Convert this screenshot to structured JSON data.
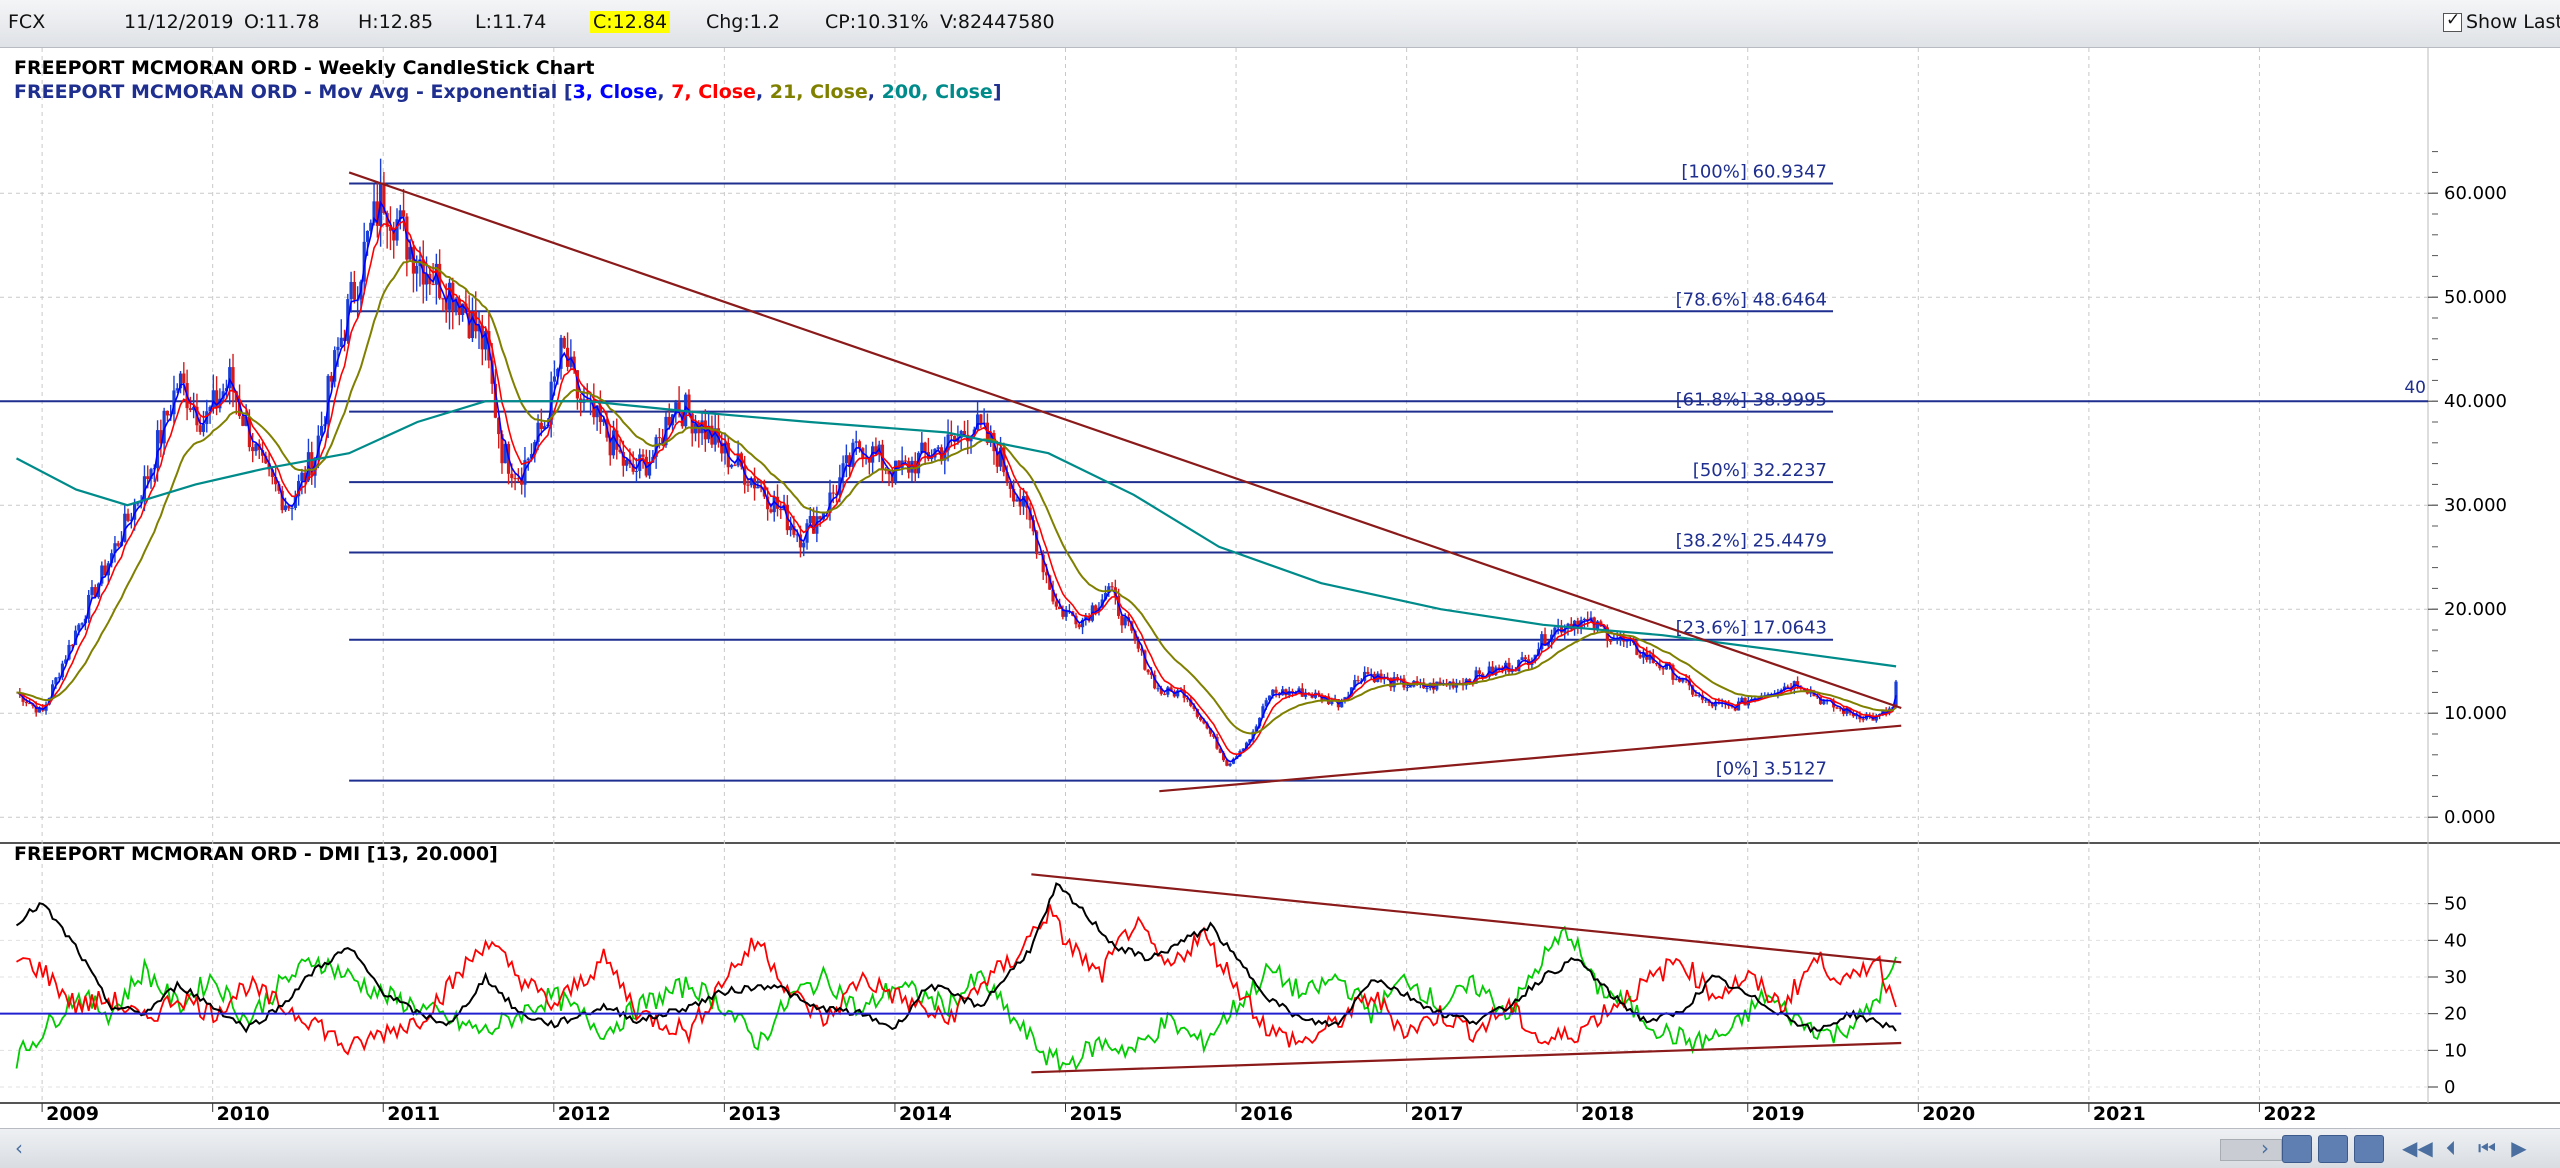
{
  "toolbar": {
    "symbol": "FCX",
    "date": "11/12/2019",
    "open": "O:11.78",
    "high": "H:12.85",
    "low": "L:11.74",
    "close": "C:12.84",
    "change": "Chg:1.2",
    "change_pct": "CP:10.31%",
    "volume": "V:82447580",
    "show_last_label": "Show Last",
    "show_last_checked": true
  },
  "colors": {
    "ema3": "#0000ff",
    "ema7": "#ff0000",
    "ema21": "#808000",
    "ema200": "#008b8b",
    "fib": "#1f2f8f",
    "trend": "#8b1a1a",
    "di_plus": "#00cc00",
    "di_minus": "#ff0000",
    "adx": "#000000",
    "close_highlight": "#ffff00"
  },
  "chart_data": [
    {
      "type": "candlestick",
      "title": "FREEPORT MCMORAN ORD - Weekly CandleStick Chart",
      "subtitle": {
        "prefix": "FREEPORT MCMORAN ORD - Mov Avg - Exponential [",
        "items": [
          {
            "text": "3, Close",
            "color": "#0000ff"
          },
          {
            "text": "7, Close",
            "color": "#ff0000"
          },
          {
            "text": "21, Close",
            "color": "#808000"
          },
          {
            "text": "200, Close",
            "color": "#008b8b"
          }
        ],
        "suffix": "]"
      },
      "x_labels": [
        "2009",
        "2010",
        "2011",
        "2012",
        "2013",
        "2014",
        "2015",
        "2016",
        "2017",
        "2018",
        "2019",
        "2020",
        "2021",
        "2022"
      ],
      "xlim": [
        2008.8,
        2023.0
      ],
      "ylim": [
        -2,
        68
      ],
      "y_ticks": [
        "0.000",
        "10.000",
        "20.000",
        "30.000",
        "40.000",
        "50.000",
        "60.000"
      ],
      "grid": true,
      "price_path": [
        [
          2008.85,
          12
        ],
        [
          2009.0,
          10
        ],
        [
          2009.2,
          18
        ],
        [
          2009.4,
          25
        ],
        [
          2009.6,
          32
        ],
        [
          2009.8,
          42
        ],
        [
          2009.95,
          38
        ],
        [
          2010.1,
          42
        ],
        [
          2010.3,
          33
        ],
        [
          2010.45,
          30
        ],
        [
          2010.6,
          35
        ],
        [
          2010.75,
          46
        ],
        [
          2010.9,
          55
        ],
        [
          2011.0,
          60
        ],
        [
          2011.15,
          55
        ],
        [
          2011.3,
          52
        ],
        [
          2011.45,
          50
        ],
        [
          2011.6,
          45
        ],
        [
          2011.7,
          35
        ],
        [
          2011.8,
          33
        ],
        [
          2011.95,
          38
        ],
        [
          2012.05,
          45
        ],
        [
          2012.15,
          40
        ],
        [
          2012.3,
          37
        ],
        [
          2012.45,
          33
        ],
        [
          2012.6,
          35
        ],
        [
          2012.7,
          40
        ],
        [
          2012.85,
          38
        ],
        [
          2013.0,
          35
        ],
        [
          2013.2,
          32
        ],
        [
          2013.45,
          27
        ],
        [
          2013.6,
          30
        ],
        [
          2013.8,
          36
        ],
        [
          2014.0,
          33
        ],
        [
          2014.2,
          35
        ],
        [
          2014.35,
          36
        ],
        [
          2014.45,
          38
        ],
        [
          2014.6,
          35
        ],
        [
          2014.8,
          28
        ],
        [
          2014.95,
          20
        ],
        [
          2015.1,
          19
        ],
        [
          2015.25,
          22
        ],
        [
          2015.4,
          17
        ],
        [
          2015.55,
          12
        ],
        [
          2015.7,
          12
        ],
        [
          2015.85,
          8
        ],
        [
          2015.95,
          5
        ],
        [
          2016.1,
          8
        ],
        [
          2016.2,
          12
        ],
        [
          2016.4,
          12
        ],
        [
          2016.6,
          11
        ],
        [
          2016.75,
          14
        ],
        [
          2016.9,
          13
        ],
        [
          2017.1,
          12.5
        ],
        [
          2017.3,
          13
        ],
        [
          2017.5,
          14
        ],
        [
          2017.7,
          15
        ],
        [
          2017.85,
          18
        ],
        [
          2018.0,
          19
        ],
        [
          2018.15,
          18
        ],
        [
          2018.35,
          16
        ],
        [
          2018.55,
          14
        ],
        [
          2018.75,
          11
        ],
        [
          2018.9,
          10.5
        ],
        [
          2019.1,
          12
        ],
        [
          2019.3,
          13
        ],
        [
          2019.45,
          11
        ],
        [
          2019.6,
          10
        ],
        [
          2019.75,
          9.5
        ],
        [
          2019.85,
          10.5
        ],
        [
          2019.87,
          12.84
        ]
      ],
      "ema200_path": [
        [
          2008.85,
          34.5
        ],
        [
          2009.2,
          31.5
        ],
        [
          2009.5,
          30
        ],
        [
          2009.9,
          32
        ],
        [
          2010.3,
          33.5
        ],
        [
          2010.8,
          35
        ],
        [
          2011.2,
          38
        ],
        [
          2011.6,
          40
        ],
        [
          2012.2,
          40
        ],
        [
          2012.8,
          39
        ],
        [
          2013.5,
          38
        ],
        [
          2014.3,
          37
        ],
        [
          2014.9,
          35
        ],
        [
          2015.4,
          31
        ],
        [
          2015.9,
          26
        ],
        [
          2016.5,
          22.5
        ],
        [
          2017.2,
          20
        ],
        [
          2017.8,
          18.5
        ],
        [
          2018.5,
          17.5
        ],
        [
          2019.2,
          16
        ],
        [
          2019.87,
          14.5
        ]
      ],
      "fib_levels": [
        {
          "label": "[100%] 60.9347",
          "value": 60.9347
        },
        {
          "label": "[78.6%] 48.6464",
          "value": 48.6464
        },
        {
          "label": "[61.8%] 38.9995",
          "value": 38.9995
        },
        {
          "label": "[50%] 32.2237",
          "value": 32.2237
        },
        {
          "label": "[38.2%] 25.4479",
          "value": 25.4479
        },
        {
          "label": "[23.6%] 17.0643",
          "value": 17.0643
        },
        {
          "label": "[0%] 3.5127",
          "value": 3.5127
        }
      ],
      "fib_x_range": [
        2010.8,
        2019.5
      ],
      "horizontal_line": {
        "value": 40,
        "label": "40"
      },
      "trendlines": [
        {
          "from": [
            2010.8,
            62
          ],
          "to": [
            2019.9,
            10.5
          ]
        },
        {
          "from": [
            2015.55,
            2.5
          ],
          "to": [
            2019.9,
            8.8
          ]
        }
      ]
    },
    {
      "type": "line",
      "title": "FREEPORT MCMORAN ORD - DMI [13, 20.000]",
      "ylim": [
        -3,
        57
      ],
      "y_ticks": [
        "0",
        "10",
        "20",
        "30",
        "40",
        "50"
      ],
      "horizontal_line": 20,
      "adx_path": [
        [
          2008.85,
          45
        ],
        [
          2009.0,
          50
        ],
        [
          2009.2,
          38
        ],
        [
          2009.4,
          22
        ],
        [
          2009.6,
          20
        ],
        [
          2009.8,
          28
        ],
        [
          2010.0,
          22
        ],
        [
          2010.2,
          16
        ],
        [
          2010.4,
          22
        ],
        [
          2010.6,
          32
        ],
        [
          2010.8,
          38
        ],
        [
          2011.0,
          26
        ],
        [
          2011.2,
          20
        ],
        [
          2011.4,
          17
        ],
        [
          2011.6,
          30
        ],
        [
          2011.8,
          20
        ],
        [
          2012.0,
          17
        ],
        [
          2012.3,
          22
        ],
        [
          2012.5,
          18
        ],
        [
          2012.8,
          22
        ],
        [
          2013.0,
          26
        ],
        [
          2013.3,
          28
        ],
        [
          2013.5,
          22
        ],
        [
          2013.8,
          20
        ],
        [
          2014.0,
          16
        ],
        [
          2014.2,
          28
        ],
        [
          2014.5,
          22
        ],
        [
          2014.8,
          38
        ],
        [
          2014.95,
          55
        ],
        [
          2015.1,
          48
        ],
        [
          2015.3,
          38
        ],
        [
          2015.5,
          35
        ],
        [
          2015.7,
          40
        ],
        [
          2015.85,
          44
        ],
        [
          2016.0,
          35
        ],
        [
          2016.2,
          24
        ],
        [
          2016.4,
          18
        ],
        [
          2016.6,
          17
        ],
        [
          2016.8,
          30
        ],
        [
          2017.0,
          25
        ],
        [
          2017.2,
          20
        ],
        [
          2017.4,
          18
        ],
        [
          2017.6,
          22
        ],
        [
          2017.8,
          30
        ],
        [
          2018.0,
          35
        ],
        [
          2018.2,
          25
        ],
        [
          2018.4,
          18
        ],
        [
          2018.6,
          20
        ],
        [
          2018.8,
          30
        ],
        [
          2019.0,
          25
        ],
        [
          2019.2,
          20
        ],
        [
          2019.4,
          15
        ],
        [
          2019.6,
          20
        ],
        [
          2019.87,
          16
        ]
      ],
      "di_minus_path": [
        [
          2008.85,
          35
        ],
        [
          2009.0,
          32
        ],
        [
          2009.2,
          22
        ],
        [
          2009.4,
          24
        ],
        [
          2009.6,
          18
        ],
        [
          2009.8,
          25
        ],
        [
          2010.0,
          20
        ],
        [
          2010.2,
          28
        ],
        [
          2010.4,
          22
        ],
        [
          2010.6,
          18
        ],
        [
          2010.8,
          10
        ],
        [
          2011.0,
          15
        ],
        [
          2011.2,
          18
        ],
        [
          2011.4,
          28
        ],
        [
          2011.6,
          40
        ],
        [
          2011.8,
          30
        ],
        [
          2012.0,
          22
        ],
        [
          2012.3,
          35
        ],
        [
          2012.5,
          20
        ],
        [
          2012.8,
          15
        ],
        [
          2013.0,
          30
        ],
        [
          2013.2,
          40
        ],
        [
          2013.4,
          25
        ],
        [
          2013.6,
          18
        ],
        [
          2013.8,
          30
        ],
        [
          2014.0,
          25
        ],
        [
          2014.3,
          18
        ],
        [
          2014.5,
          28
        ],
        [
          2014.7,
          35
        ],
        [
          2014.9,
          48
        ],
        [
          2015.0,
          40
        ],
        [
          2015.2,
          30
        ],
        [
          2015.4,
          45
        ],
        [
          2015.6,
          32
        ],
        [
          2015.8,
          42
        ],
        [
          2016.0,
          28
        ],
        [
          2016.2,
          15
        ],
        [
          2016.4,
          12
        ],
        [
          2016.6,
          18
        ],
        [
          2016.8,
          25
        ],
        [
          2017.0,
          15
        ],
        [
          2017.2,
          20
        ],
        [
          2017.4,
          15
        ],
        [
          2017.6,
          22
        ],
        [
          2017.8,
          12
        ],
        [
          2018.0,
          15
        ],
        [
          2018.2,
          22
        ],
        [
          2018.4,
          28
        ],
        [
          2018.6,
          35
        ],
        [
          2018.8,
          25
        ],
        [
          2019.0,
          30
        ],
        [
          2019.2,
          22
        ],
        [
          2019.4,
          35
        ],
        [
          2019.6,
          28
        ],
        [
          2019.75,
          36
        ],
        [
          2019.87,
          22
        ]
      ],
      "di_plus_path": [
        [
          2008.85,
          8
        ],
        [
          2009.0,
          15
        ],
        [
          2009.2,
          25
        ],
        [
          2009.4,
          20
        ],
        [
          2009.6,
          32
        ],
        [
          2009.8,
          22
        ],
        [
          2010.0,
          30
        ],
        [
          2010.2,
          18
        ],
        [
          2010.4,
          28
        ],
        [
          2010.6,
          35
        ],
        [
          2010.8,
          30
        ],
        [
          2011.0,
          25
        ],
        [
          2011.2,
          22
        ],
        [
          2011.4,
          18
        ],
        [
          2011.6,
          15
        ],
        [
          2011.8,
          20
        ],
        [
          2012.0,
          25
        ],
        [
          2012.3,
          15
        ],
        [
          2012.5,
          22
        ],
        [
          2012.8,
          28
        ],
        [
          2013.0,
          22
        ],
        [
          2013.2,
          12
        ],
        [
          2013.4,
          25
        ],
        [
          2013.6,
          30
        ],
        [
          2013.8,
          20
        ],
        [
          2014.0,
          28
        ],
        [
          2014.3,
          22
        ],
        [
          2014.5,
          30
        ],
        [
          2014.7,
          18
        ],
        [
          2014.9,
          8
        ],
        [
          2015.0,
          6
        ],
        [
          2015.2,
          12
        ],
        [
          2015.4,
          10
        ],
        [
          2015.6,
          18
        ],
        [
          2015.8,
          12
        ],
        [
          2016.0,
          22
        ],
        [
          2016.2,
          32
        ],
        [
          2016.4,
          25
        ],
        [
          2016.6,
          30
        ],
        [
          2016.8,
          20
        ],
        [
          2017.0,
          30
        ],
        [
          2017.2,
          22
        ],
        [
          2017.4,
          28
        ],
        [
          2017.6,
          20
        ],
        [
          2017.8,
          35
        ],
        [
          2017.95,
          43
        ],
        [
          2018.1,
          28
        ],
        [
          2018.3,
          22
        ],
        [
          2018.5,
          15
        ],
        [
          2018.7,
          12
        ],
        [
          2018.9,
          15
        ],
        [
          2019.1,
          25
        ],
        [
          2019.3,
          18
        ],
        [
          2019.5,
          14
        ],
        [
          2019.7,
          20
        ],
        [
          2019.87,
          33
        ]
      ],
      "trendlines": [
        {
          "from": [
            2014.8,
            58
          ],
          "to": [
            2019.9,
            34
          ]
        },
        {
          "from": [
            2014.8,
            4
          ],
          "to": [
            2019.9,
            12
          ]
        }
      ],
      "x_labels_ref": "shared"
    }
  ]
}
